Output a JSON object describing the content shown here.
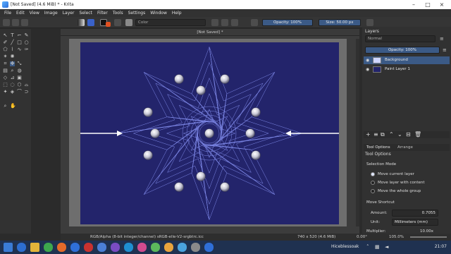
{
  "window": {
    "title": "[Not Saved]  (4.6 MiB)  * - Krita",
    "controls": [
      "minimize-icon",
      "maximize-icon",
      "close-icon"
    ]
  },
  "menu": [
    "File",
    "Edit",
    "View",
    "Image",
    "Layer",
    "Select",
    "Filter",
    "Tools",
    "Settings",
    "Window",
    "Help"
  ],
  "toolbar": {
    "blend_placeholder": "Color",
    "opacity_label": "Opacity: 100%",
    "size_label": "Size: 50.00 px"
  },
  "document": {
    "tab_title": "[Not Saved] *"
  },
  "layers": {
    "header": "Layers",
    "blend_mode": "Normal",
    "opacity": "Opacity: 100%",
    "items": [
      {
        "name": "Background",
        "selected": true
      },
      {
        "name": "Paint Layer 1",
        "selected": false
      }
    ]
  },
  "tool_options": {
    "tabs": [
      "Tool Options",
      "Arrange"
    ],
    "header": "Tool Options",
    "selection_mode_label": "Selection Mode",
    "modes": [
      "Move current layer",
      "Move layer with content",
      "Move the whole group"
    ],
    "move_shortcut_label": "Move Shortcut",
    "amount_label": "Amount:",
    "amount_value": "0.7055",
    "unit_label": "Unit:",
    "unit_value": "Millimeters (mm)",
    "multiplier_label": "Multiplier:",
    "multiplier_value": "10.00x"
  },
  "status": {
    "color_space": "RGB/Alpha (8-bit integer/channel)  sRGB-elle-V2-srgbtrc.icc",
    "dimensions": "740 x 520 (4.6 MiB)",
    "rotation": "0.00°",
    "zoom": "105.0%"
  },
  "taskbar": {
    "app_label": "Hiceblessoak",
    "time": "21:07"
  },
  "colors": {
    "canvas_bg": "#23246b",
    "star_line": "#8f9bff",
    "accent": "#3b5a86"
  }
}
